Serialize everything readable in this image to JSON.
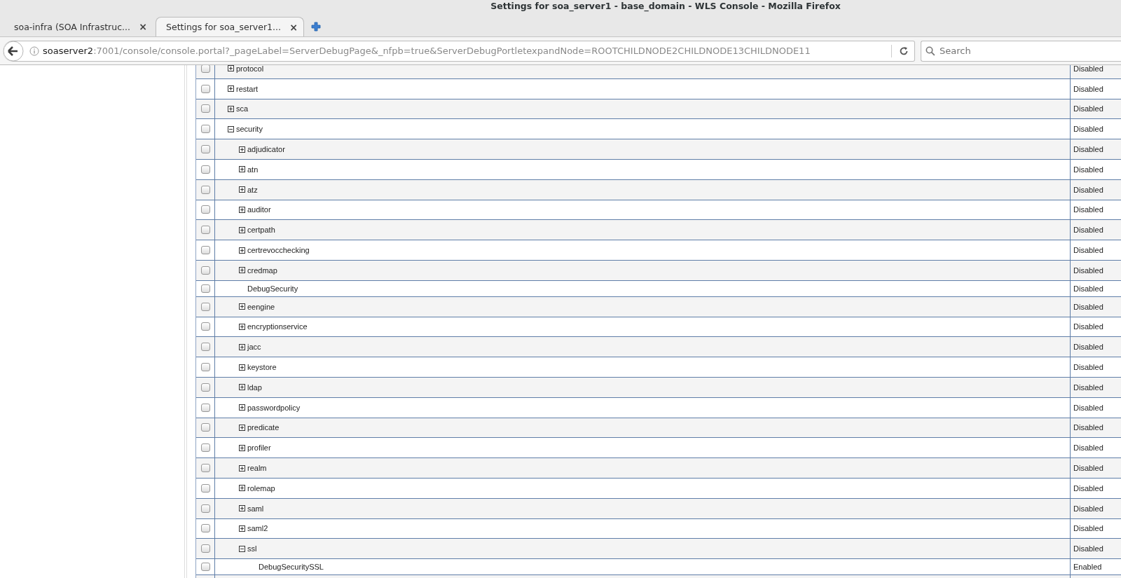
{
  "window": {
    "title": "Settings for soa_server1 - base_domain - WLS Console - Mozilla Firefox"
  },
  "tabs": [
    {
      "label": "soa-infra (SOA Infrastruc...",
      "close": "×",
      "selected": false
    },
    {
      "label": "Settings for soa_server1...",
      "close": "×",
      "selected": true
    }
  ],
  "address_bar": {
    "host": "soaserver2",
    "rest": ":7001/console/console.portal?_pageLabel=ServerDebugPage&_nfpb=true&ServerDebugPortletexpandNode=ROOTCHILDNODE2CHILDNODE13CHILDNODE11"
  },
  "search": {
    "placeholder": "Search"
  },
  "rows": [
    {
      "kind": "folder",
      "name": "protocol",
      "expanded": false,
      "checked": false,
      "status": "Disabled"
    },
    {
      "kind": "folder",
      "name": "restart",
      "expanded": false,
      "checked": false,
      "status": "Disabled"
    },
    {
      "kind": "folder",
      "name": "sca",
      "expanded": false,
      "checked": false,
      "status": "Disabled"
    },
    {
      "kind": "folder",
      "name": "security",
      "expanded": true,
      "checked": false,
      "status": "Disabled",
      "children": [
        {
          "kind": "folder",
          "name": "adjudicator",
          "expanded": false,
          "checked": false,
          "status": "Disabled"
        },
        {
          "kind": "folder",
          "name": "atn",
          "expanded": false,
          "checked": false,
          "status": "Disabled"
        },
        {
          "kind": "folder",
          "name": "atz",
          "expanded": false,
          "checked": false,
          "status": "Disabled"
        },
        {
          "kind": "folder",
          "name": "auditor",
          "expanded": false,
          "checked": false,
          "status": "Disabled"
        },
        {
          "kind": "folder",
          "name": "certpath",
          "expanded": false,
          "checked": false,
          "status": "Disabled"
        },
        {
          "kind": "folder",
          "name": "certrevocchecking",
          "expanded": false,
          "checked": false,
          "status": "Disabled"
        },
        {
          "kind": "folder",
          "name": "credmap",
          "expanded": false,
          "checked": false,
          "status": "Disabled"
        },
        {
          "kind": "leaf",
          "name": "DebugSecurity",
          "checked": false,
          "status": "Disabled"
        },
        {
          "kind": "folder",
          "name": "eengine",
          "expanded": false,
          "checked": false,
          "status": "Disabled"
        },
        {
          "kind": "folder",
          "name": "encryptionservice",
          "expanded": false,
          "checked": false,
          "status": "Disabled"
        },
        {
          "kind": "folder",
          "name": "jacc",
          "expanded": false,
          "checked": false,
          "status": "Disabled"
        },
        {
          "kind": "folder",
          "name": "keystore",
          "expanded": false,
          "checked": false,
          "status": "Disabled"
        },
        {
          "kind": "folder",
          "name": "ldap",
          "expanded": false,
          "checked": false,
          "status": "Disabled"
        },
        {
          "kind": "folder",
          "name": "passwordpolicy",
          "expanded": false,
          "checked": false,
          "status": "Disabled"
        },
        {
          "kind": "folder",
          "name": "predicate",
          "expanded": false,
          "checked": false,
          "status": "Disabled"
        },
        {
          "kind": "folder",
          "name": "profiler",
          "expanded": false,
          "checked": false,
          "status": "Disabled"
        },
        {
          "kind": "folder",
          "name": "realm",
          "expanded": false,
          "checked": false,
          "status": "Disabled"
        },
        {
          "kind": "folder",
          "name": "rolemap",
          "expanded": false,
          "checked": false,
          "status": "Disabled"
        },
        {
          "kind": "folder",
          "name": "saml",
          "expanded": false,
          "checked": false,
          "status": "Disabled"
        },
        {
          "kind": "folder",
          "name": "saml2",
          "expanded": false,
          "checked": false,
          "status": "Disabled"
        },
        {
          "kind": "folder",
          "name": "ssl",
          "expanded": true,
          "checked": false,
          "status": "Disabled",
          "children": [
            {
              "kind": "leaf",
              "name": "DebugSecuritySSL",
              "checked": false,
              "status": "Enabled"
            }
          ]
        }
      ]
    }
  ]
}
